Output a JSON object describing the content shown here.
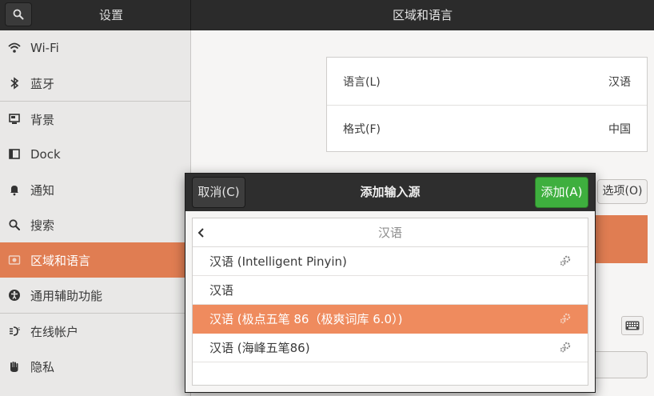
{
  "header": {
    "sidebar_title": "设置",
    "panel_title": "区域和语言"
  },
  "sidebar": {
    "items": [
      {
        "label": "Wi-Fi",
        "icon": "wifi-icon"
      },
      {
        "label": "蓝牙",
        "icon": "bluetooth-icon"
      },
      {
        "label": "背景",
        "icon": "background-icon"
      },
      {
        "label": "Dock",
        "icon": "dock-icon"
      },
      {
        "label": "通知",
        "icon": "bell-icon"
      },
      {
        "label": "搜索",
        "icon": "search-icon"
      },
      {
        "label": "区域和语言",
        "icon": "region-icon",
        "active": true
      },
      {
        "label": "通用辅助功能",
        "icon": "accessibility-icon"
      },
      {
        "label": "在线帐户",
        "icon": "online-accounts-icon"
      },
      {
        "label": "隐私",
        "icon": "privacy-hand-icon"
      }
    ]
  },
  "main": {
    "language_label": "语言(L)",
    "language_value": "汉语",
    "formats_label": "格式(F)",
    "formats_value": "中国",
    "options_button": "选项(O)"
  },
  "dialog": {
    "title": "添加输入源",
    "cancel_label": "取消(C)",
    "add_label": "添加(A)",
    "list_title": "汉语",
    "rows": [
      {
        "label": "汉语 (Intelligent Pinyin)",
        "has_settings": true
      },
      {
        "label": "汉语",
        "has_settings": false
      },
      {
        "label": "汉语 (极点五笔 86（极爽词库 6.0）)",
        "has_settings": true,
        "selected": true
      },
      {
        "label": "汉语 (海峰五笔86)",
        "has_settings": true
      }
    ]
  },
  "colors": {
    "accent": "#e07d52",
    "selected_row": "#ef8b5e",
    "add_button": "#3eaf3e",
    "header_bg": "#2b2b2b"
  }
}
